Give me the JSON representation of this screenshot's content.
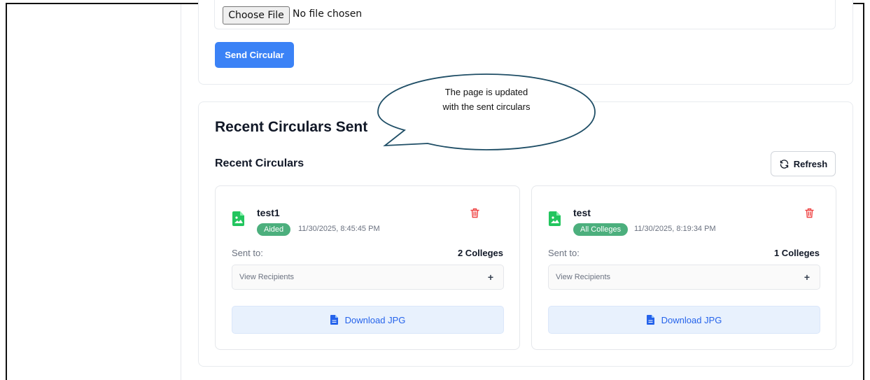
{
  "upload": {
    "choose_file_label": "Choose File",
    "no_file_text": "No file chosen",
    "send_button": "Send Circular"
  },
  "recent": {
    "section_title": "Recent Circulars Sent",
    "subtitle": "Recent Circulars",
    "refresh_label": "Refresh",
    "circulars": [
      {
        "title": "test1",
        "badge": "Aided",
        "timestamp": "11/30/2025, 8:45:45 PM",
        "sent_to_label": "Sent to:",
        "sent_to_value": "2 Colleges",
        "view_recipients": "View Recipients",
        "expand_symbol": "+",
        "download_label": "Download JPG"
      },
      {
        "title": "test",
        "badge": "All Colleges",
        "timestamp": "11/30/2025, 8:19:34 PM",
        "sent_to_label": "Sent to:",
        "sent_to_value": "1 Colleges",
        "view_recipients": "View Recipients",
        "expand_symbol": "+",
        "download_label": "Download JPG"
      }
    ]
  },
  "callout": {
    "text_line1": "The page is updated",
    "text_line2": "with the sent circulars"
  },
  "icons": {
    "file_image": "file-image-icon",
    "trash": "trash-icon",
    "refresh": "refresh-icon",
    "document": "document-icon"
  },
  "colors": {
    "primary": "#3b82f6",
    "badge": "#4caf7d",
    "file_icon": "#22c55e",
    "trash": "#ef4444",
    "download_bg": "#e8f1fd",
    "download_text": "#2563eb"
  }
}
